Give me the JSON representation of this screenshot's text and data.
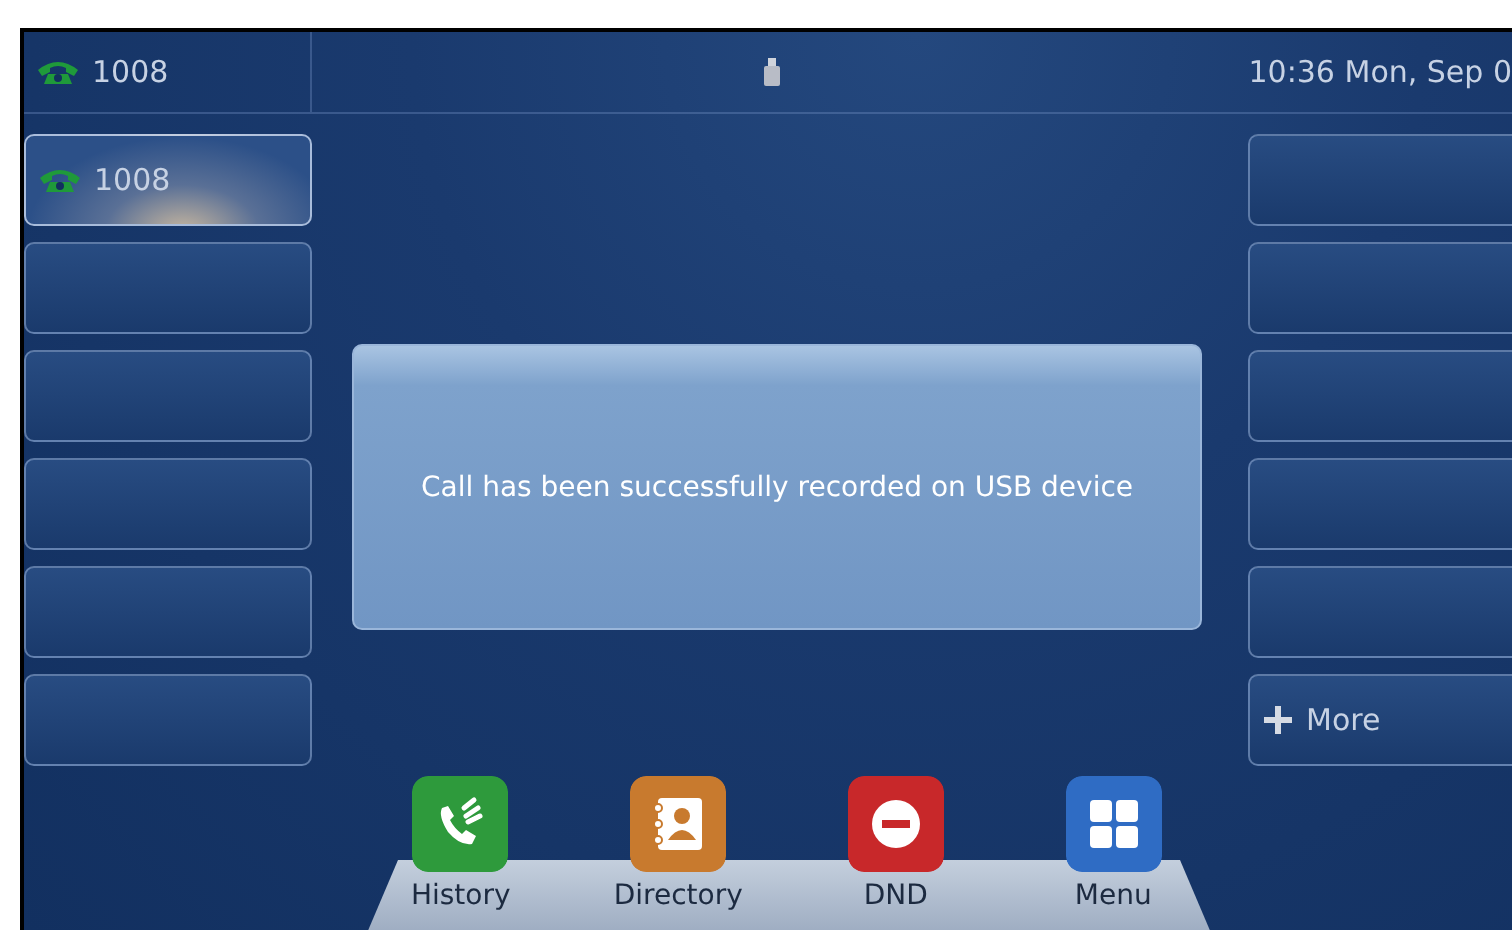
{
  "status_bar": {
    "account": "1008",
    "clock": "10:36 Mon, Sep 0"
  },
  "left_keys": [
    {
      "kind": "line",
      "label": "1008",
      "selected": true
    },
    {
      "kind": "blank",
      "selected": false
    },
    {
      "kind": "blank",
      "selected": false
    },
    {
      "kind": "blank",
      "selected": false
    },
    {
      "kind": "blank",
      "selected": false
    },
    {
      "kind": "blank",
      "selected": false
    }
  ],
  "right_keys": [
    {
      "kind": "blank"
    },
    {
      "kind": "blank"
    },
    {
      "kind": "blank"
    },
    {
      "kind": "blank"
    },
    {
      "kind": "blank"
    },
    {
      "kind": "more",
      "label": "More"
    }
  ],
  "dialog": {
    "message": "Call has been successfully recorded on USB device"
  },
  "dock": [
    {
      "kind": "history",
      "label": "History"
    },
    {
      "kind": "directory",
      "label": "Directory"
    },
    {
      "kind": "dnd",
      "label": "DND"
    },
    {
      "kind": "menu",
      "label": "Menu"
    }
  ]
}
